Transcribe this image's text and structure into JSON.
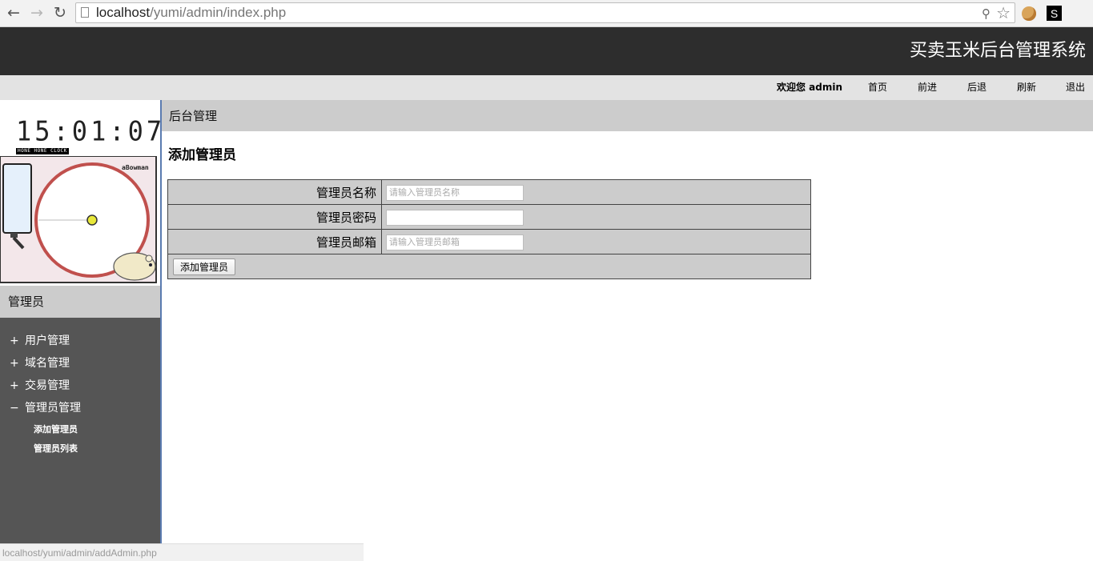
{
  "browser": {
    "url_host": "localhost",
    "url_path": "/yumi/admin/index.php"
  },
  "header": {
    "app_title": "买卖玉米后台管理系统",
    "welcome": "欢迎您 admin",
    "links": [
      "首页",
      "前进",
      "后退",
      "刷新",
      "退出"
    ]
  },
  "sidebar": {
    "clock_time": "15:01:07",
    "clock_label": "HONE HONE CLOCK",
    "hamster_label": "aBowman",
    "section_title": "管理员",
    "menu": [
      {
        "symbol": "+",
        "label": "用户管理"
      },
      {
        "symbol": "+",
        "label": "域名管理"
      },
      {
        "symbol": "+",
        "label": "交易管理"
      },
      {
        "symbol": "−",
        "label": "管理员管理"
      }
    ],
    "submenu": [
      "添加管理员",
      "管理员列表"
    ]
  },
  "main": {
    "breadcrumb": "后台管理",
    "page_title": "添加管理员",
    "form": {
      "name_label": "管理员名称",
      "name_placeholder": "请输入管理员名称",
      "password_label": "管理员密码",
      "email_label": "管理员邮箱",
      "email_placeholder": "请输入管理员邮箱",
      "submit_label": "添加管理员"
    }
  },
  "status_url": "localhost/yumi/admin/addAdmin.php",
  "colors": {
    "header_bg": "#2d2d2d",
    "subbar_bg": "#e3e3e3",
    "sidebar_bg": "#555555",
    "panel_gray": "#cccccc"
  }
}
